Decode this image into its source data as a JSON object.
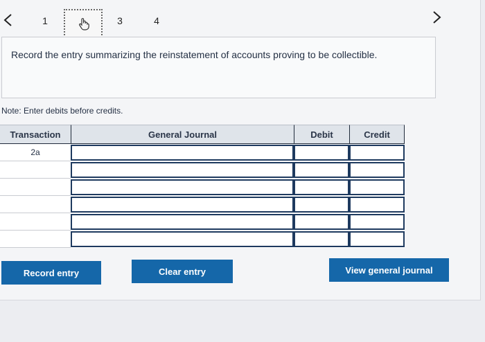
{
  "nav": {
    "prev_icon": "chevron-left-icon",
    "next_icon": "chevron-right-icon",
    "steps": [
      "1",
      "3",
      "4"
    ],
    "current_step_icon": "hand-pointer-icon"
  },
  "question": {
    "text": "Record the entry summarizing the reinstatement of accounts proving to be collectible."
  },
  "note": "Note: Enter debits before credits.",
  "journal": {
    "headers": {
      "transaction": "Transaction",
      "general_journal": "General Journal",
      "debit": "Debit",
      "credit": "Credit"
    },
    "rows": [
      {
        "transaction": "2a",
        "account": "",
        "debit": "",
        "credit": ""
      },
      {
        "transaction": "",
        "account": "",
        "debit": "",
        "credit": ""
      },
      {
        "transaction": "",
        "account": "",
        "debit": "",
        "credit": ""
      },
      {
        "transaction": "",
        "account": "",
        "debit": "",
        "credit": ""
      },
      {
        "transaction": "",
        "account": "",
        "debit": "",
        "credit": ""
      },
      {
        "transaction": "",
        "account": "",
        "debit": "",
        "credit": ""
      }
    ]
  },
  "buttons": {
    "record": "Record entry",
    "clear": "Clear entry",
    "view": "View general journal"
  },
  "colors": {
    "button": "#1567a9",
    "header_bg": "#dfe4ea",
    "input_border": "#1e3a5f"
  }
}
